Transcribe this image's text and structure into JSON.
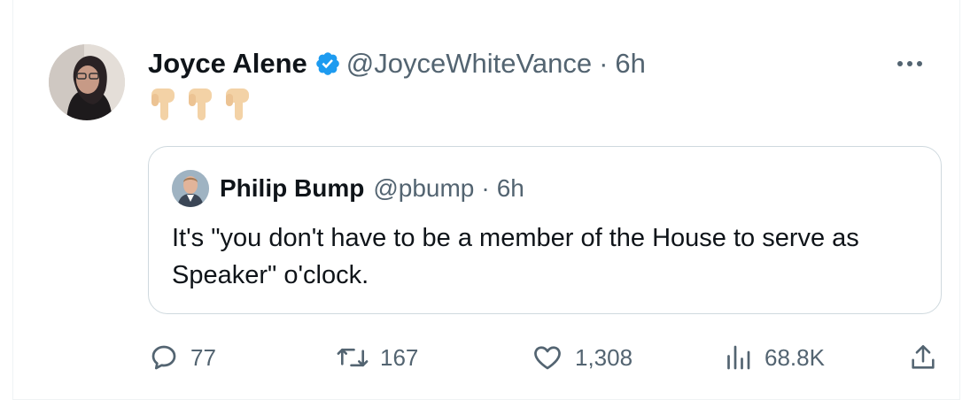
{
  "tweet": {
    "author_name": "Joyce Alene",
    "author_handle": "@JoyceWhiteVance",
    "separator": "·",
    "time": "6h",
    "emoji": "👇👇👇"
  },
  "quote": {
    "author_name": "Philip Bump",
    "author_handle": "@pbump",
    "separator": "·",
    "time": "6h",
    "text": "It's \"you don't have to be a member of the House to serve as Speaker\" o'clock."
  },
  "actions": {
    "replies": "77",
    "retweets": "167",
    "likes": "1,308",
    "views": "68.8K"
  },
  "icons": {
    "verified": "verified-badge-icon",
    "more": "more-options-icon",
    "reply": "reply-icon",
    "retweet": "retweet-icon",
    "like": "heart-icon",
    "views": "views-icon",
    "share": "share-icon"
  },
  "colors": {
    "verified_blue": "#1d9bf0",
    "muted_text": "#536471",
    "border": "#cfd9de",
    "emoji_skin": "#f3d2a6"
  }
}
